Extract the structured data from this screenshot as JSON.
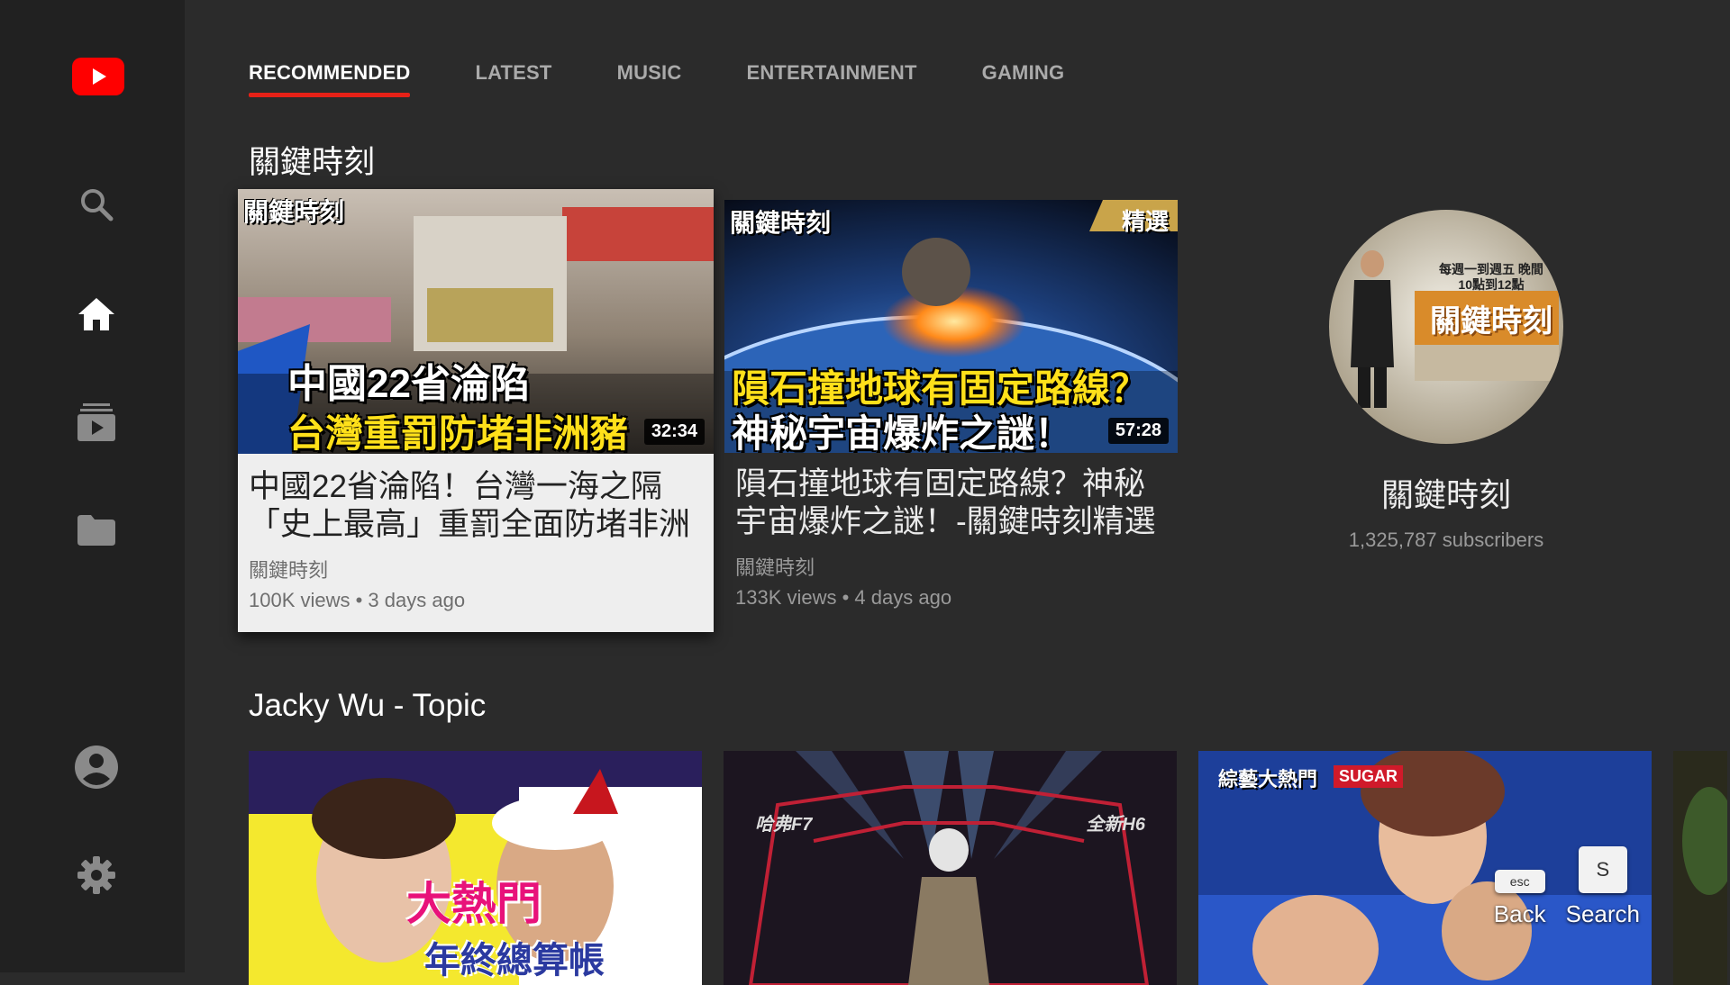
{
  "tabs": [
    {
      "label": "RECOMMENDED",
      "active": true
    },
    {
      "label": "LATEST",
      "active": false
    },
    {
      "label": "MUSIC",
      "active": false
    },
    {
      "label": "ENTERTAINMENT",
      "active": false
    },
    {
      "label": "GAMING",
      "active": false
    }
  ],
  "sidebar": {
    "items": [
      {
        "icon": "youtube-logo-icon"
      },
      {
        "icon": "search-icon"
      },
      {
        "icon": "home-icon"
      },
      {
        "icon": "subscriptions-icon"
      },
      {
        "icon": "library-folder-icon"
      },
      {
        "icon": "account-icon"
      },
      {
        "icon": "settings-gear-icon"
      }
    ]
  },
  "sections": [
    {
      "title": "關鍵時刻",
      "videos": [
        {
          "title": "中國22省淪陷！台灣一海之隔「史上最高」重罰全面防堵非洲",
          "channel": "關鍵時刻",
          "meta": "100K views • 3 days ago",
          "duration": "32:34",
          "thumb_text_top": "中國22省淪陷",
          "thumb_text_bottom": "台灣重罰防堵非洲豬",
          "thumb_logo": "關鍵時刻",
          "focused": true
        },
        {
          "title": "隕石撞地球有固定路線？神秘宇宙爆炸之謎！-關鍵時刻精選 馬",
          "channel": "關鍵時刻",
          "meta": "133K views • 4 days ago",
          "duration": "57:28",
          "thumb_text_top": "隕石撞地球有固定路線？",
          "thumb_text_bottom": "神秘宇宙爆炸之謎！",
          "thumb_logo": "關鍵時刻",
          "thumb_badge": "精選",
          "focused": false
        }
      ],
      "channel": {
        "name": "關鍵時刻",
        "subscribers": "1,325,787 subscribers",
        "avatar_text": "關鍵時刻",
        "avatar_small_text": "每週一到週五 晚間10點到12點"
      }
    },
    {
      "title": "Jacky Wu - Topic",
      "videos": [
        {
          "thumb_text": "大熱門",
          "thumb_sub": "年終總算帳"
        },
        {
          "thumb_text_left": "哈弗F7",
          "thumb_text_right": "全新H6"
        },
        {
          "thumb_text": "綜藝大熱門",
          "thumb_badge": "SUGAR"
        }
      ]
    }
  ],
  "hints": {
    "back_key": "esc",
    "back_label": "Back",
    "search_key": "S",
    "search_label": "Search"
  },
  "colors": {
    "background": "#2b2b2b",
    "sidebar": "#212121",
    "accent_red": "#e62117",
    "focused_card": "#eeeeee"
  }
}
